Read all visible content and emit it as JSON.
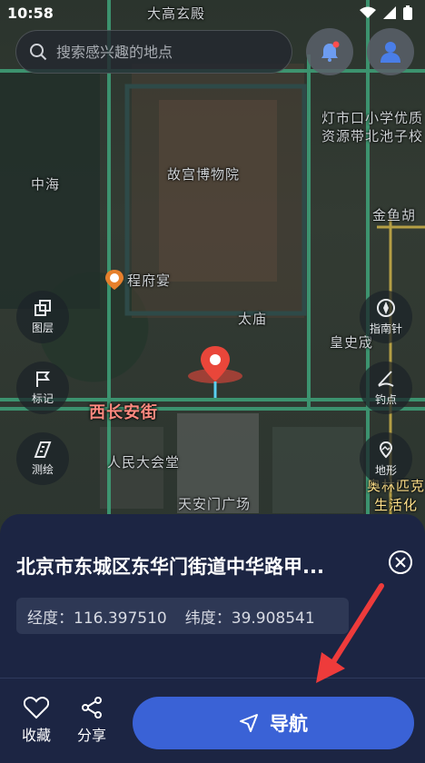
{
  "status_bar": {
    "time": "10:58"
  },
  "search": {
    "placeholder": "搜索感兴趣的地点"
  },
  "map": {
    "labels": {
      "dagao": "大高玄殿",
      "zhonghai": "中海",
      "gugong": "故宫博物院",
      "chengfu": "程府宴",
      "taimiao": "太庙",
      "huangshicheng": "皇史宬",
      "xichangan": "西长安街",
      "renmin": "人民大会堂",
      "tiananmen": "天安门广场",
      "denshikou": "灯市口小学优质",
      "ziyuan": "资源带北池子校",
      "jinyu": "金鱼胡",
      "aoyun": "奥林匹克",
      "shenghuo": "生活化"
    }
  },
  "tools_left": [
    {
      "label": "图层",
      "icon": "layers-icon"
    },
    {
      "label": "标记",
      "icon": "flag-icon"
    },
    {
      "label": "测绘",
      "icon": "ruler-icon"
    }
  ],
  "tools_right": [
    {
      "label": "指南针",
      "icon": "compass-icon"
    },
    {
      "label": "钓点",
      "icon": "fishing-icon"
    },
    {
      "label": "地形",
      "icon": "terrain-icon"
    }
  ],
  "sheet": {
    "title": "北京市东城区东华门街道中华路甲...",
    "longitude": "经度：116.397510",
    "latitude": "纬度：39.908541",
    "favorite_label": "收藏",
    "share_label": "分享",
    "navigate_label": "导航"
  },
  "colors": {
    "accent": "#3a62d6",
    "sheet_bg": "#1c2543",
    "road": "#3fa37a"
  }
}
